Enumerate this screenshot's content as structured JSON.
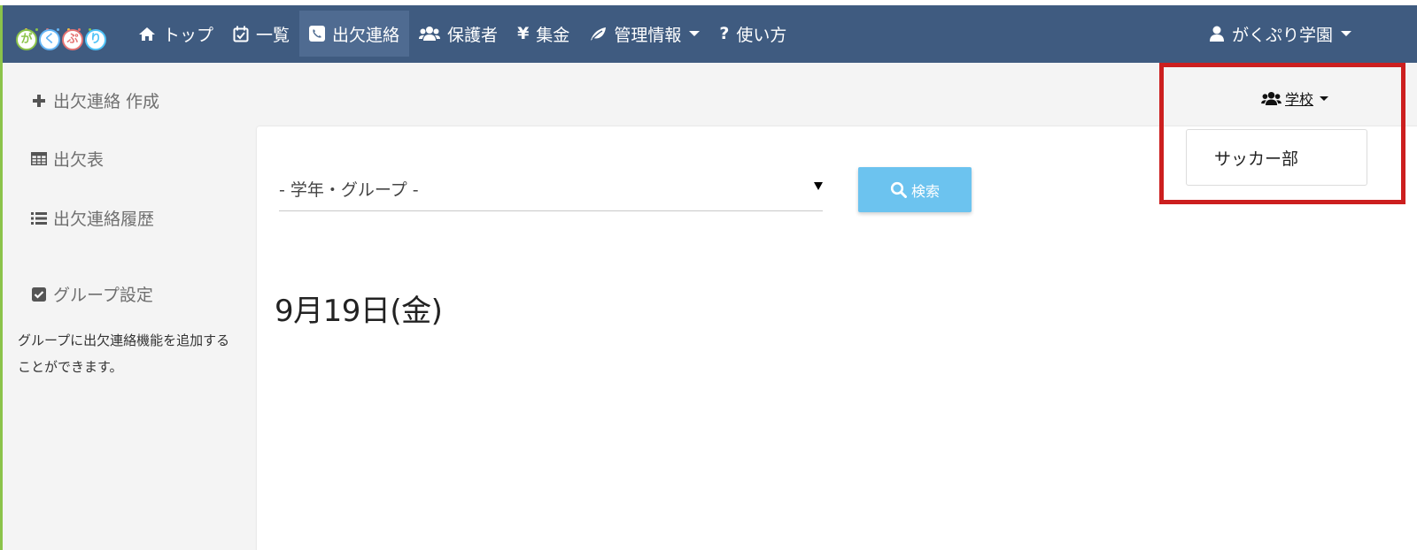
{
  "app": {
    "logo_letters": [
      "が",
      "く",
      "ぷ",
      "り"
    ],
    "brand_colors": {
      "navbar": "#3f5b80",
      "active": "#4f6b91",
      "accent_green": "#8bc34a",
      "search_button": "#6cc3ef",
      "highlight": "#cc1f1f"
    }
  },
  "navbar": {
    "items": [
      {
        "label": "トップ",
        "icon": "home-icon"
      },
      {
        "label": "一覧",
        "icon": "calendar-check-icon"
      },
      {
        "label": "出欠連絡",
        "icon": "phone-square-icon",
        "active": true
      },
      {
        "label": "保護者",
        "icon": "users-icon"
      },
      {
        "label": "集金",
        "icon": "yen-icon"
      },
      {
        "label": "管理情報",
        "icon": "leaf-icon",
        "dropdown": true
      },
      {
        "label": "使い方",
        "icon": "question-icon"
      }
    ],
    "user": {
      "label": "がくぷり学園",
      "icon": "user-icon"
    }
  },
  "sidebar": {
    "items": [
      {
        "label": "出欠連絡 作成",
        "icon": "plus-icon"
      },
      {
        "label": "出欠表",
        "icon": "table-icon"
      },
      {
        "label": "出欠連絡履歴",
        "icon": "list-icon"
      },
      {
        "label": "グループ設定",
        "icon": "check-square-icon"
      }
    ],
    "note": "グループに出欠連絡機能を追加することができます。"
  },
  "main": {
    "group_select": {
      "value": "- 学年・グループ -"
    },
    "search_button": {
      "label": "検索",
      "icon": "search-icon"
    },
    "date_heading": "9月19日(金)"
  },
  "group_dropdown": {
    "toggle_label": "学校",
    "icon": "users-icon",
    "items": [
      "サッカー部"
    ]
  }
}
